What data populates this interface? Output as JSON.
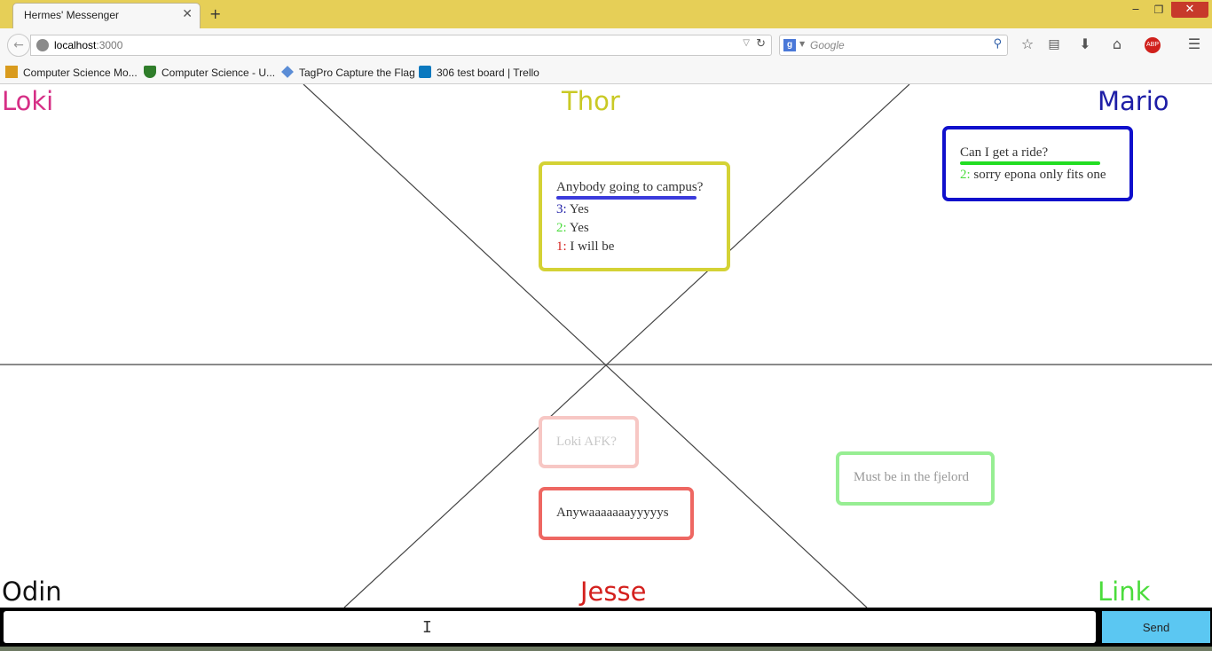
{
  "browser": {
    "tab_title": "Hermes' Messenger",
    "tab_close_glyph": "✕",
    "new_tab_glyph": "+",
    "window": {
      "minimize": "‒",
      "maximize": "❐",
      "close": "✕"
    },
    "url_host": "localhost",
    "url_port": ":3000",
    "search_engine_letter": "g",
    "search_placeholder": "Google",
    "addon_badge": "ABP",
    "bookmarks": [
      "Computer Science Mo...",
      "Computer Science - U...",
      "TagPro Capture the Flag",
      "306 test board | Trello"
    ]
  },
  "users": {
    "loki": {
      "name": "Loki",
      "color": "#d62f86"
    },
    "thor": {
      "name": "Thor",
      "color": "#c9c925"
    },
    "mario": {
      "name": "Mario",
      "color": "#1e1ea6"
    },
    "odin": {
      "name": "Odin",
      "color": "#111111"
    },
    "jesse": {
      "name": "Jesse",
      "color": "#d4201d"
    },
    "link": {
      "name": "Link",
      "color": "#4bdc3c"
    }
  },
  "bubbles": {
    "thor": {
      "question": "Anybody going to campus?",
      "underline_color": "#3b3bdc",
      "replies": [
        {
          "num": "3:",
          "num_color": "#1e1ea6",
          "text": "Yes"
        },
        {
          "num": "2:",
          "num_color": "#4bdc3c",
          "text": "Yes"
        },
        {
          "num": "1:",
          "num_color": "#d4201d",
          "text": "I will be"
        }
      ]
    },
    "mario": {
      "question": "Can I get a ride?",
      "underline_color": "#22dd22",
      "replies": [
        {
          "num": "2:",
          "num_color": "#4bdc3c",
          "text": "sorry epona only fits one"
        }
      ]
    },
    "loki": {
      "text": "Loki AFK?"
    },
    "jesse": {
      "text": "Anywaaaaaaayyyyys"
    },
    "link": {
      "text": "Must be in the fjelord"
    }
  },
  "composer": {
    "input_value": "",
    "send_label": "Send"
  }
}
